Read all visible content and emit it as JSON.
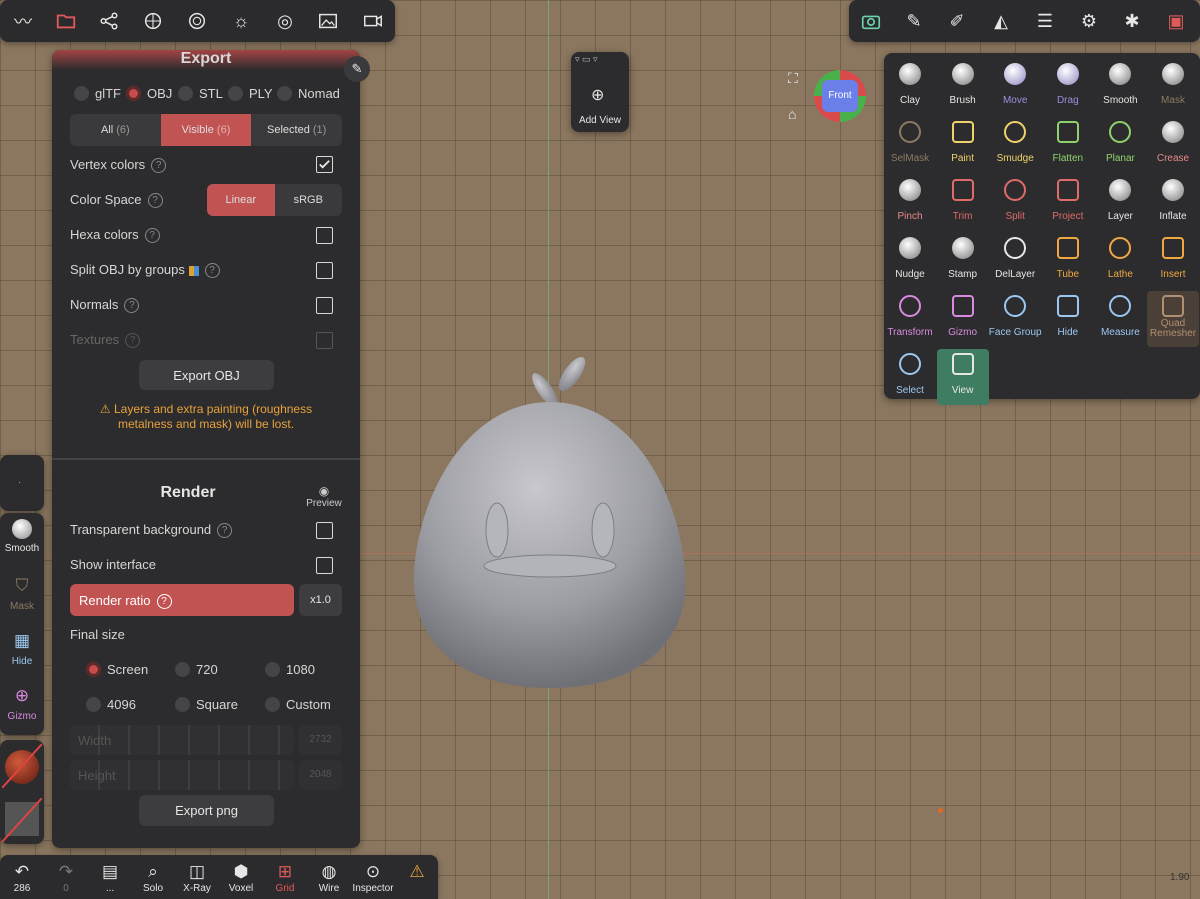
{
  "top_left_bar": {
    "icons": [
      "brush-icon",
      "folder-icon",
      "scene-tree-icon",
      "material-icon",
      "shading-icon",
      "light-icon",
      "camera-lens-icon",
      "background-image-icon",
      "video-icon"
    ]
  },
  "top_right_bar": {
    "icons": [
      "camera-icon",
      "paint-brush-icon",
      "stroke-icon",
      "symmetry-icon",
      "layers-icon",
      "settings-icon",
      "debug-icon",
      "gift-icon"
    ]
  },
  "export": {
    "title": "Export",
    "formats": [
      "glTF",
      "OBJ",
      "STL",
      "PLY",
      "Nomad"
    ],
    "selected_format": "OBJ",
    "scope": {
      "all": "All",
      "all_count": "(6)",
      "visible": "Visible",
      "visible_count": "(6)",
      "selected": "Selected",
      "selected_count": "(1)"
    },
    "vertex_colors": "Vertex colors",
    "color_space": "Color Space",
    "linear": "Linear",
    "srgb": "sRGB",
    "hexa_colors": "Hexa colors",
    "split_obj": "Split OBJ by groups",
    "normals": "Normals",
    "textures": "Textures",
    "export_button": "Export OBJ",
    "warning": "⚠ Layers and extra painting (roughness metalness and mask) will be lost."
  },
  "render": {
    "title": "Render",
    "preview": "Preview",
    "transparent": "Transparent background",
    "show_interface": "Show interface",
    "render_ratio": "Render ratio",
    "ratio_value": "x1.0",
    "final_size": "Final size",
    "sizes": [
      "Screen",
      "720",
      "1080",
      "4096",
      "Square",
      "Custom"
    ],
    "width_label": "Width",
    "width_value": "2732",
    "height_label": "Height",
    "height_value": "2048",
    "export_png": "Export png"
  },
  "view_widget": {
    "add_view": "Add View"
  },
  "gizmo": {
    "face": "Front"
  },
  "tools": [
    {
      "label": "Clay",
      "color": "#e6e6e6"
    },
    {
      "label": "Brush",
      "color": "#e6e6e6"
    },
    {
      "label": "Move",
      "color": "#9c8ee0"
    },
    {
      "label": "Drag",
      "color": "#9c8ee0"
    },
    {
      "label": "Smooth",
      "color": "#e6e6e6"
    },
    {
      "label": "Mask",
      "color": "#8d7a62"
    },
    {
      "label": "SelMask",
      "color": "#8d7a62"
    },
    {
      "label": "Paint",
      "color": "#f0d26a"
    },
    {
      "label": "Smudge",
      "color": "#f0d26a"
    },
    {
      "label": "Flatten",
      "color": "#8ed36b"
    },
    {
      "label": "Planar",
      "color": "#8ed36b"
    },
    {
      "label": "Crease",
      "color": "#e88a8a"
    },
    {
      "label": "Pinch",
      "color": "#e88a8a"
    },
    {
      "label": "Trim",
      "color": "#e06b6b"
    },
    {
      "label": "Split",
      "color": "#e06b6b"
    },
    {
      "label": "Project",
      "color": "#e06b6b"
    },
    {
      "label": "Layer",
      "color": "#e6e6e6"
    },
    {
      "label": "Inflate",
      "color": "#e6e6e6"
    },
    {
      "label": "Nudge",
      "color": "#e6e6e6"
    },
    {
      "label": "Stamp",
      "color": "#e6e6e6"
    },
    {
      "label": "DelLayer",
      "color": "#e6e6e6"
    },
    {
      "label": "Tube",
      "color": "#f0a840"
    },
    {
      "label": "Lathe",
      "color": "#f0a840"
    },
    {
      "label": "Insert",
      "color": "#f0a840"
    },
    {
      "label": "Transform",
      "color": "#d88ae0"
    },
    {
      "label": "Gizmo",
      "color": "#d88ae0"
    },
    {
      "label": "Face Group",
      "color": "#9cc7f0"
    },
    {
      "label": "Hide",
      "color": "#9cc7f0"
    },
    {
      "label": "Measure",
      "color": "#9cc7f0"
    },
    {
      "label": "Quad Remesher",
      "color": "#b09070"
    },
    {
      "label": "Select",
      "color": "#9cc7f0"
    },
    {
      "label": "View",
      "color": "#e6e6e6"
    }
  ],
  "left_tools": [
    {
      "label": "Smooth"
    },
    {
      "label": "Mask"
    },
    {
      "label": "Hide"
    },
    {
      "label": "Gizmo"
    }
  ],
  "bottom_bar": [
    {
      "label": "286",
      "glyph": "↶"
    },
    {
      "label": "0",
      "glyph": "↷"
    },
    {
      "label": "...",
      "glyph": "▤"
    },
    {
      "label": "Solo",
      "glyph": "⌕"
    },
    {
      "label": "X-Ray",
      "glyph": "◫"
    },
    {
      "label": "Voxel",
      "glyph": "⬢"
    },
    {
      "label": "Grid",
      "glyph": "⊞"
    },
    {
      "label": "Wire",
      "glyph": "◍"
    },
    {
      "label": "Inspector",
      "glyph": "⊙"
    },
    {
      "label": "",
      "glyph": "⚠"
    }
  ],
  "zoom": "1.90"
}
